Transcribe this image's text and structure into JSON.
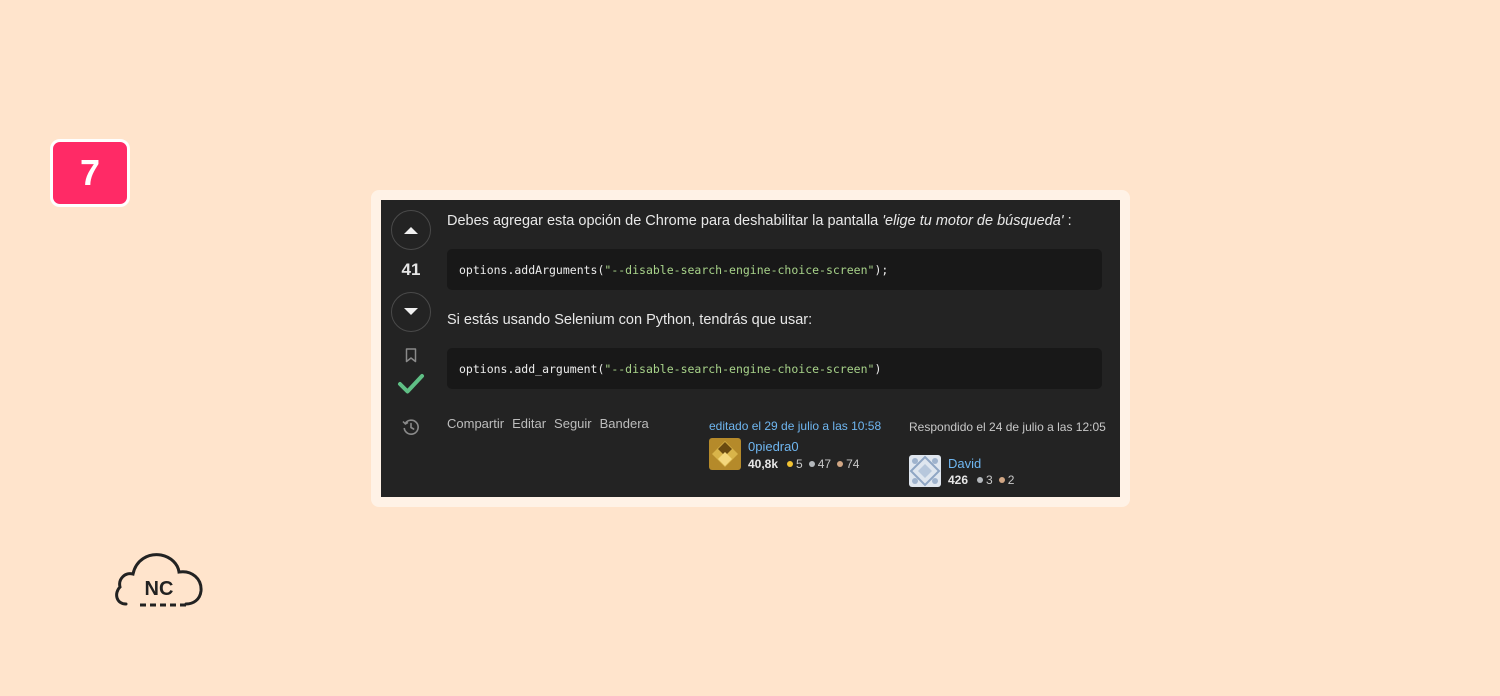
{
  "step_number": "7",
  "answer": {
    "score": "41",
    "paragraph1_prefix": "Debes agregar esta opción de Chrome para deshabilitar la pantalla ",
    "paragraph1_emphasis": "'elige tu motor de búsqueda'",
    "paragraph1_suffix": " :",
    "code1_prefix": "options.addArguments(",
    "code1_string": "\"--disable-search-engine-choice-screen\"",
    "code1_suffix": ");",
    "paragraph2": "Si estás usando Selenium con Python, tendrás que usar:",
    "code2_prefix": "options.add_argument(",
    "code2_string": "\"--disable-search-engine-choice-screen\"",
    "code2_suffix": ")"
  },
  "actions": {
    "share": "Compartir",
    "edit": "Editar",
    "follow": "Seguir",
    "flag": "Bandera"
  },
  "editor": {
    "label": "editado el 29 de julio a las 10:58",
    "name": "0piedra0",
    "reputation": "40,8k",
    "gold": "5",
    "silver": "47",
    "bronze": "74"
  },
  "author": {
    "label": "Respondido el 24 de julio a las 12:05",
    "name": "David",
    "reputation": "426",
    "silver": "3",
    "bronze": "2"
  },
  "logo_text": "NC",
  "colors": {
    "background": "#ffe4cc",
    "badge": "#ff2a66",
    "card": "#232323",
    "accepted_check": "#5fbf85",
    "link": "#6fb6f0"
  },
  "icons": [
    "upvote-icon",
    "downvote-icon",
    "bookmark-icon",
    "accepted-check-icon",
    "history-icon",
    "cloud-logo-icon"
  ]
}
